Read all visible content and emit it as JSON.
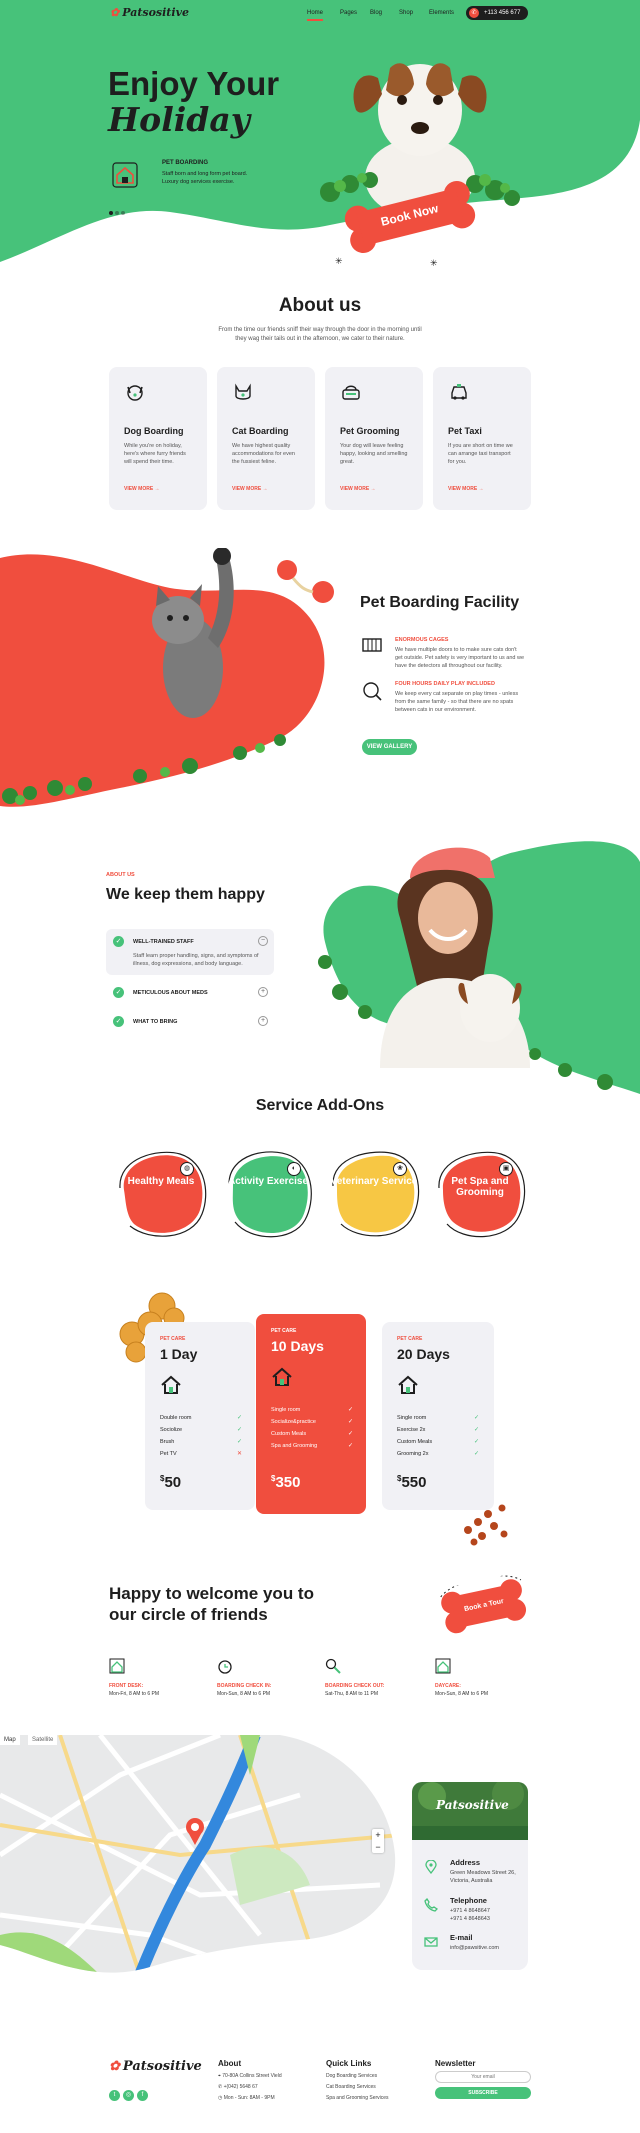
{
  "nav": {
    "logo": "Patsositive",
    "items": [
      "Home",
      "Pages",
      "Blog",
      "Shop",
      "Elements"
    ],
    "phone": "+113 456 677"
  },
  "hero": {
    "title_line1": "Enjoy Your",
    "title_line2": "Holiday",
    "feature_title": "PET BOARDING",
    "feature_text_line1": "Staff born and long form pet board.",
    "feature_text_line2": "Luxury dog services exercise.",
    "cta": "Book Now"
  },
  "about": {
    "title": "About us",
    "intro_line1": "From the time our friends sniff their way through the door in the morning until",
    "intro_line2": "they wag their tails out in the afternoon, we cater to their nature.",
    "cards": [
      {
        "icon": "dog-icon",
        "title": "Dog Boarding",
        "text": "While you're on holiday, here's where furry friends will spend their time.",
        "more": "VIEW MORE →"
      },
      {
        "icon": "cat-icon",
        "title": "Cat Boarding",
        "text": "We have highest quality accommodations for even the fussiest feline.",
        "more": "VIEW MORE →"
      },
      {
        "icon": "grooming-icon",
        "title": "Pet Grooming",
        "text": "Your dog will leave feeling happy, looking and smelling great.",
        "more": "VIEW MORE →"
      },
      {
        "icon": "taxi-icon",
        "title": "Pet Taxi",
        "text": "If you are short on time we can arrange taxi transport for you.",
        "more": "VIEW MORE →"
      }
    ]
  },
  "facility": {
    "title": "Pet Boarding Facility",
    "items": [
      {
        "icon": "cage-icon",
        "label": "ENORMOUS CAGES",
        "text": "We have multiple doors to to make sure cats don't get outside. Pet safety is very important to us and we have the detectors all throughout our facility."
      },
      {
        "icon": "play-icon",
        "label": "FOUR HOURS DAILY PLAY INCLUDED",
        "text": "We keep every cat separate on play times - unless from the same family - so that there are no spats between cats in our environment."
      }
    ],
    "button": "VIEW GALLERY"
  },
  "happy": {
    "eyebrow": "ABOUT US",
    "title": "We keep them happy",
    "items": [
      {
        "title": "WELL-TRAINED STAFF",
        "text": "Staff learn proper handling, signs, and symptoms of illness, dog expressions, and body language.",
        "toggle": "−"
      },
      {
        "title": "METICULOUS ABOUT MEDS",
        "toggle": "+"
      },
      {
        "title": "WHAT TO BRING",
        "toggle": "+"
      }
    ]
  },
  "addons": {
    "title": "Service Add-Ons",
    "items": [
      {
        "label": "Healthy Meals",
        "color": "#f04e3e",
        "icon": "food-icon"
      },
      {
        "label": "Activity Exercise",
        "color": "#47c27a",
        "icon": "ball-icon"
      },
      {
        "label": "Veterinary Service",
        "color": "#f7c744",
        "icon": "paw-icon"
      },
      {
        "label": "Pet Spa and Grooming",
        "color": "#f04e3e",
        "icon": "basket-icon"
      }
    ]
  },
  "pricing": {
    "plans": [
      {
        "eyebrow": "PET CARE",
        "title": "1 Day",
        "rows": [
          [
            "Double room",
            "✓"
          ],
          [
            "Sociolize",
            "✓"
          ],
          [
            "Brush",
            "✓"
          ],
          [
            "Pet TV",
            "✕"
          ]
        ],
        "price": "50"
      },
      {
        "eyebrow": "PET CARE",
        "title": "10 Days",
        "rows": [
          [
            "Single room",
            "✓"
          ],
          [
            "Socialize&practice",
            "✓"
          ],
          [
            "Custom Meals",
            "✓"
          ],
          [
            "Spa and Grooming",
            "✓"
          ]
        ],
        "price": "350"
      },
      {
        "eyebrow": "PET CARE",
        "title": "20 Days",
        "rows": [
          [
            "Single room",
            "✓"
          ],
          [
            "Exercise 2x",
            "✓"
          ],
          [
            "Custom Meals",
            "✓"
          ],
          [
            "Grooming 2x",
            "✓"
          ]
        ],
        "price": "550"
      }
    ],
    "currency": "$"
  },
  "welcome": {
    "title_line1": "Happy to welcome you to",
    "title_line2": "our circle of friends",
    "badge": "Book a Tour",
    "hours": [
      {
        "icon": "house-icon",
        "label": "FRONT DESK:",
        "time": "Mon-Fri, 8 AM to 6 PM"
      },
      {
        "icon": "clock-icon",
        "label": "BOARDING CHECK IN:",
        "time": "Mon-Sun, 8 AM to 6 PM"
      },
      {
        "icon": "search-icon",
        "label": "BOARDING CHECK OUT:",
        "time": "Sat-Thu, 8 AM to 11 PM"
      },
      {
        "icon": "house-icon",
        "label": "DAYCARE:",
        "time": "Mon-Sun, 8 AM to 6 PM"
      }
    ]
  },
  "map": {
    "tabs": [
      "Map",
      "Satellite"
    ],
    "zoom_in": "+",
    "zoom_out": "−"
  },
  "contact": {
    "logo": "Patsositive",
    "address_label": "Address",
    "address": "Green Meadows Street 26, Victoria, Australia",
    "phone_label": "Telephone",
    "phones": [
      "+971 4 8648647",
      "+971 4 8648643"
    ],
    "email_label": "E-mail",
    "email": "info@pawsitive.com"
  },
  "footer": {
    "logo": "Patsositive",
    "about_title": "About",
    "about_lines": [
      "70-80A Collins Street Vield",
      "+(042) 5648 67",
      "Mon - Sun: 8AM - 9PM"
    ],
    "links_title": "Quick Links",
    "links": [
      "Dog Boarding Services",
      "Cat Boarding Services",
      "Spa and Grooming Services"
    ],
    "newsletter_title": "Newsletter",
    "email_placeholder": "Your email",
    "subscribe": "SUBSCRIBE"
  },
  "colors": {
    "green": "#47c27a",
    "red": "#f04e3e",
    "yellow": "#f7c744",
    "dark": "#1e1e1e"
  }
}
